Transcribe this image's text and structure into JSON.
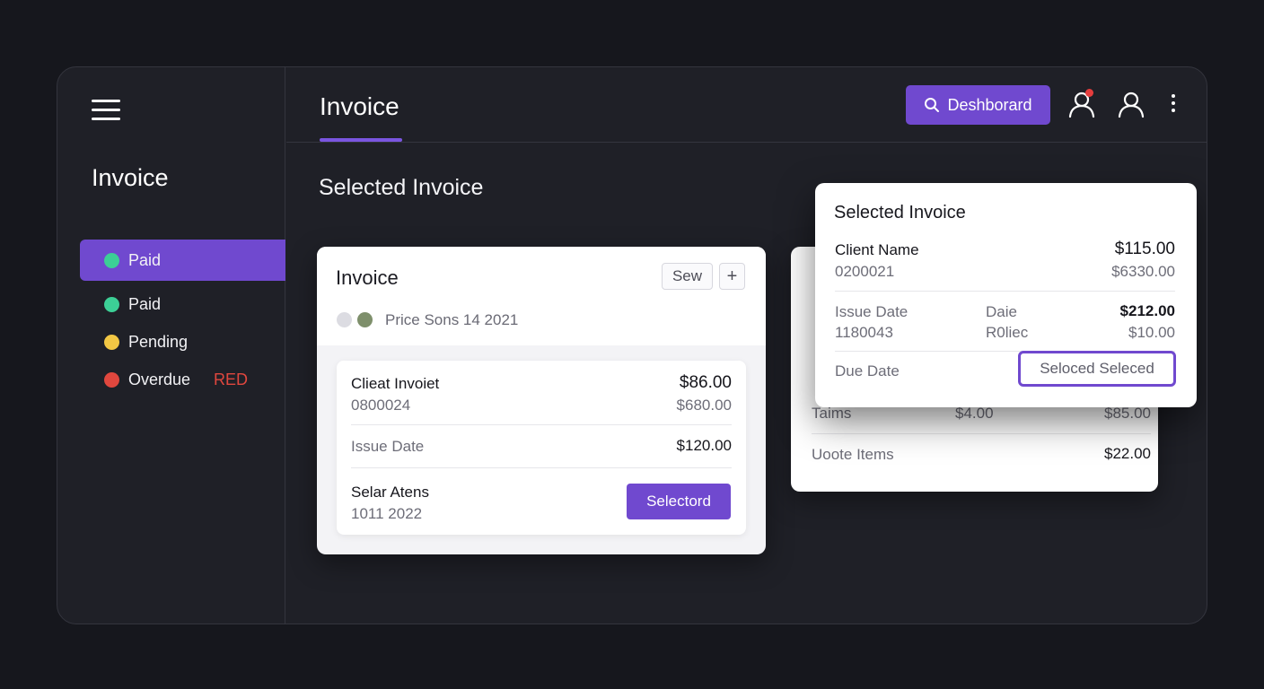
{
  "sidebar": {
    "title": "Invoice",
    "items": [
      {
        "label": "Paid",
        "color": "#3ccf96",
        "active": true
      },
      {
        "label": "Paid",
        "color": "#3ccf96",
        "active": false
      },
      {
        "label": "Pending",
        "color": "#f2c744",
        "active": false
      },
      {
        "label": "Overdue",
        "color": "#e0473e",
        "active": false,
        "tag": "RED"
      }
    ]
  },
  "header": {
    "tab_label": "Invoice",
    "search_button_label": "Deshborard"
  },
  "main": {
    "section_title": "Selected Invoice"
  },
  "invoice_card": {
    "title": "Invoice",
    "chip_label": "Sew",
    "add_label": "+",
    "meta": "Price Sons 14 2021",
    "row1": {
      "label": "Clieat Invoiet",
      "sub": "0800024",
      "amount": "$86.00",
      "sub_amount": "$680.00"
    },
    "row2": {
      "label": "Issue Date",
      "amount": "$120.00"
    },
    "row3": {
      "label": "Selar Atens",
      "sub": "1011 2022",
      "button_label": "Selectord"
    }
  },
  "back_card": {
    "row1": {
      "label": "Taims",
      "mid": "$4.00",
      "amount": "$85.00"
    },
    "row2": {
      "label": "Uoote Items",
      "amount": "$22.00"
    }
  },
  "popup_card": {
    "title": "Selected Invoice",
    "row1": {
      "label": "Client Name",
      "sub": "0200021",
      "amount": "$115.00",
      "sub_amount": "$6330.00"
    },
    "row2": {
      "label": "Issue Date",
      "sub": "1180043",
      "mid_label": "Daie",
      "mid_sub": "R0liec",
      "amount": "$212.00",
      "sub_amount": "$10.00"
    },
    "row3": {
      "label": "Due Date",
      "button_label": "Seloced Seleced"
    }
  },
  "colors": {
    "accent": "#7049cf",
    "background": "#16171d",
    "panel": "#1f2027"
  }
}
